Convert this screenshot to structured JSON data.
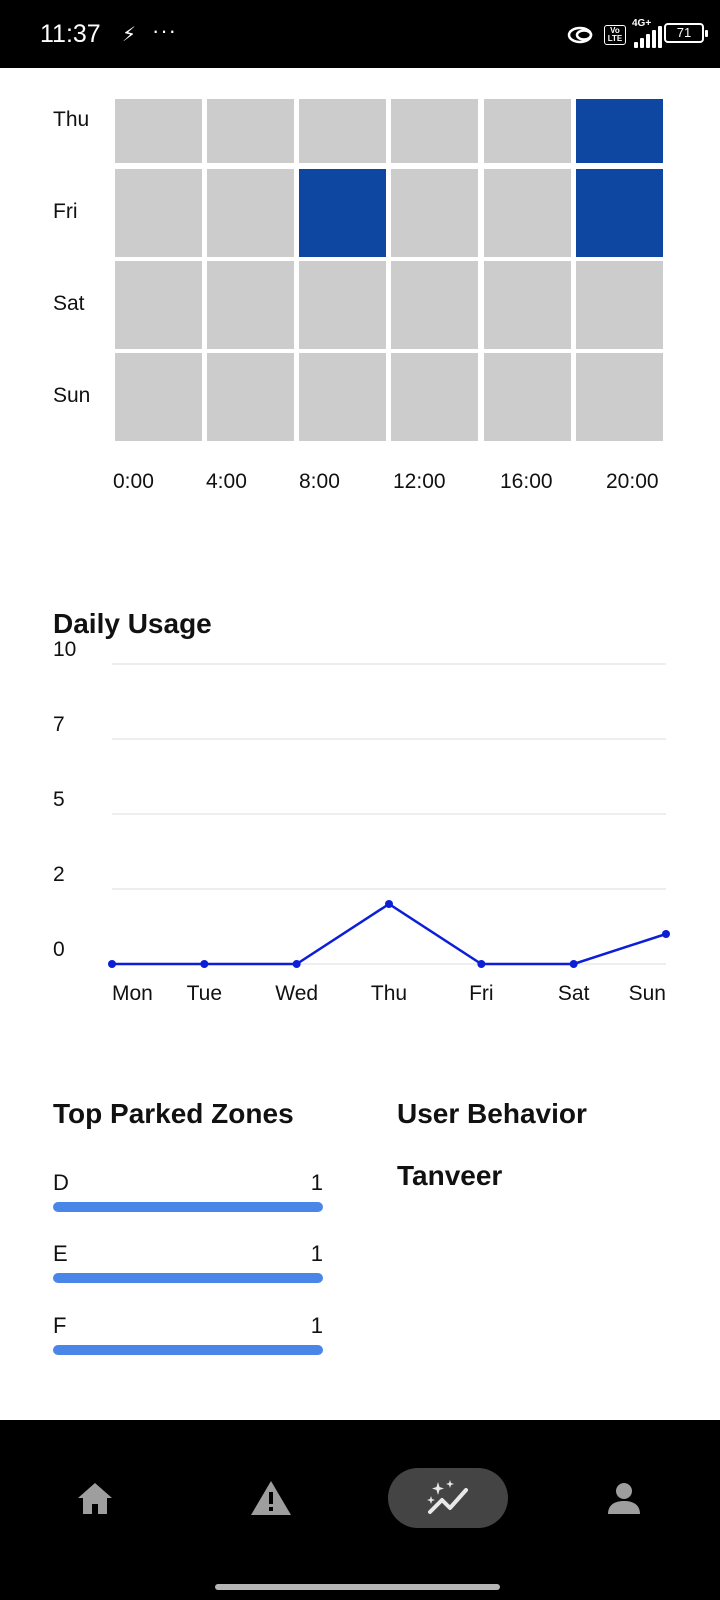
{
  "status_bar": {
    "time": "11:37",
    "volte": "Vo LTE",
    "network": "4G+",
    "battery": "71"
  },
  "heatmap": {
    "rows": [
      "Thu",
      "Fri",
      "Sat",
      "Sun"
    ],
    "columns": [
      "0:00",
      "4:00",
      "8:00",
      "12:00",
      "16:00",
      "20:00"
    ],
    "active_cells": [
      [
        0,
        5
      ],
      [
        1,
        2
      ],
      [
        1,
        5
      ]
    ],
    "colors": {
      "active": "#0d47a1",
      "inactive": "#cccccc"
    }
  },
  "daily_usage": {
    "title": "Daily Usage"
  },
  "chart_data": {
    "type": "line",
    "title": "Daily Usage",
    "categories": [
      "Mon",
      "Tue",
      "Wed",
      "Thu",
      "Fri",
      "Sat",
      "Sun"
    ],
    "series": [
      {
        "values": [
          0,
          0,
          0,
          2,
          0,
          0,
          1
        ]
      }
    ],
    "yticks": [
      "0",
      "2",
      "5",
      "7",
      "10"
    ],
    "ylim": [
      0,
      10
    ],
    "grid": true,
    "color": "#0d1fd6"
  },
  "top_zones": {
    "title": "Top Parked Zones",
    "items": [
      {
        "name": "D",
        "count": "1",
        "fraction": 1
      },
      {
        "name": "E",
        "count": "1",
        "fraction": 1
      },
      {
        "name": "F",
        "count": "1",
        "fraction": 1
      }
    ]
  },
  "user_behavior": {
    "title": "User Behavior",
    "user": "Tanveer"
  },
  "nav": {
    "items": [
      {
        "name": "home-icon",
        "active": false
      },
      {
        "name": "warning-icon",
        "active": false
      },
      {
        "name": "analytics-icon",
        "active": true
      },
      {
        "name": "person-icon",
        "active": false
      }
    ]
  }
}
